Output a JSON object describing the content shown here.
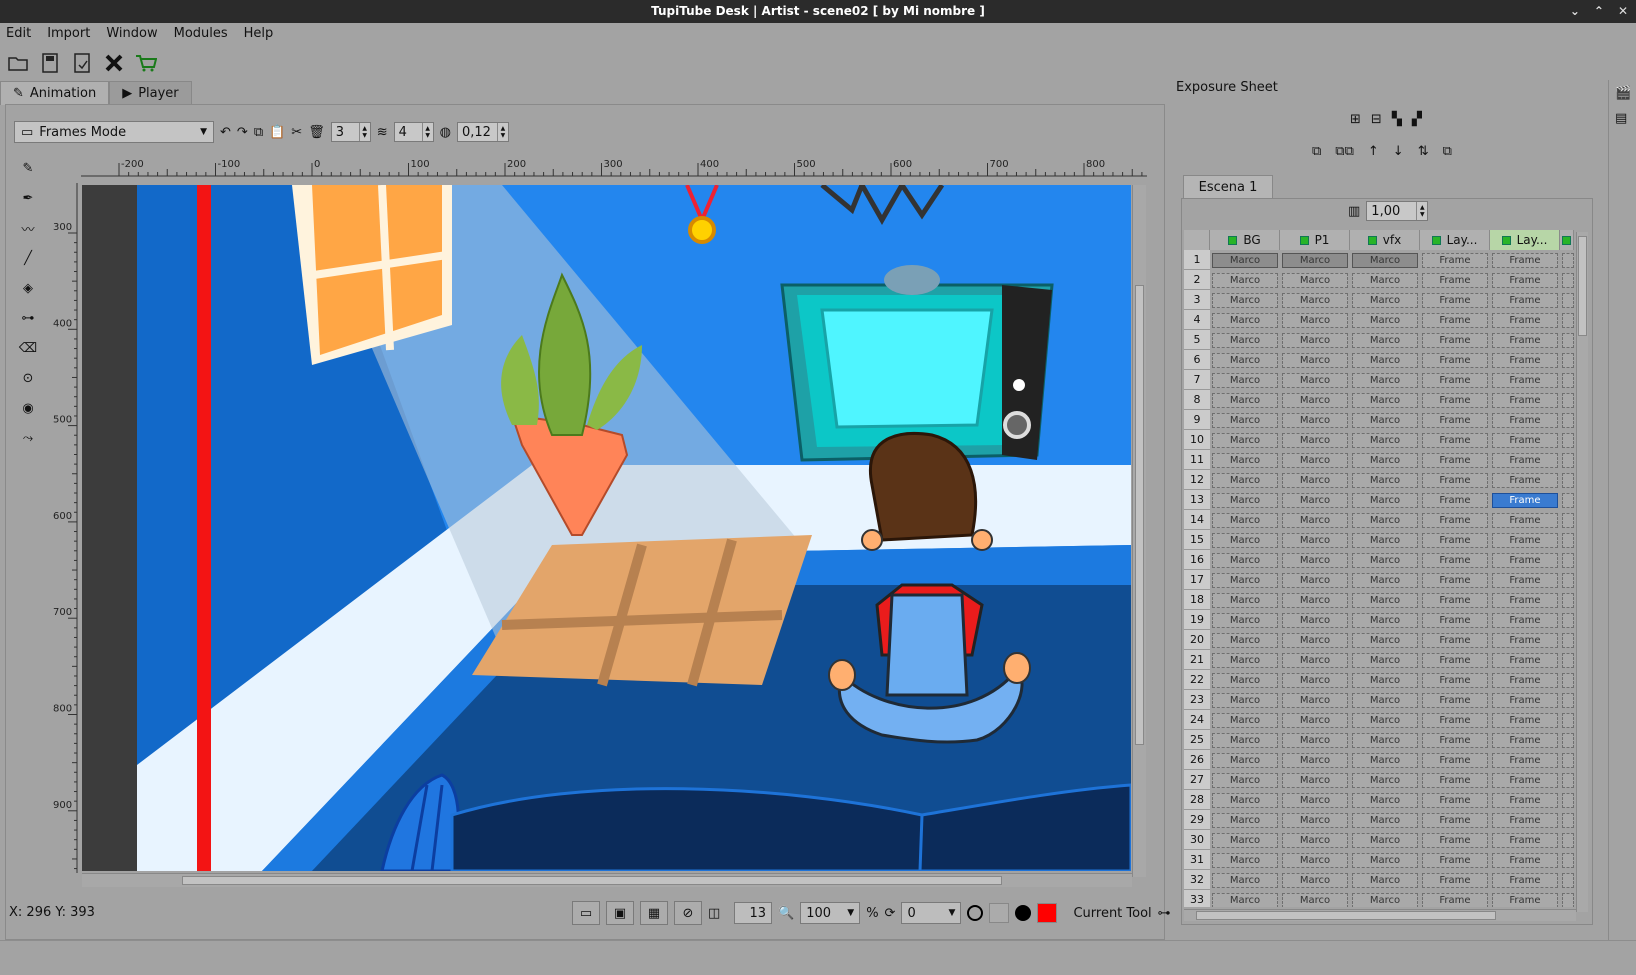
{
  "window": {
    "title": "TupiTube Desk | Artist - scene02 [ by Mi nombre ]"
  },
  "menubar": [
    "Edit",
    "Import",
    "Window",
    "Modules",
    "Help"
  ],
  "tabs": [
    {
      "label": "Animation"
    },
    {
      "label": "Player"
    }
  ],
  "frames_toolbar": {
    "mode": "Frames Mode",
    "spin1": "3",
    "spin2": "4",
    "opacity": "0,12"
  },
  "rulers": {
    "h_ticks": [
      "-200",
      "-100",
      "0",
      "100",
      "200",
      "300",
      "400",
      "500",
      "600",
      "700",
      "800"
    ],
    "v_ticks": [
      "300",
      "400",
      "500",
      "600",
      "700",
      "800",
      "900"
    ]
  },
  "status": {
    "coords": "X: 296 Y: 393",
    "frame": "13",
    "zoom": "100",
    "zoom_unit": "%",
    "rotation": "0",
    "current_tool": "Current Tool"
  },
  "colors": {
    "stroke": "#000000",
    "fill": "#ff0000",
    "selection": "#3a7bd0",
    "layer_ok": "#28b428"
  },
  "exposure": {
    "title": "Exposure Sheet",
    "scene_tab": "Escena 1",
    "fps": "1,00",
    "layers": [
      "BG",
      "P1",
      "vfx",
      "Lay...",
      "Lay..."
    ],
    "row_count": 33,
    "cell_label_marco": "Marco",
    "cell_label_frame": "Frame",
    "selected_row": 13,
    "selected_layer": 4
  }
}
